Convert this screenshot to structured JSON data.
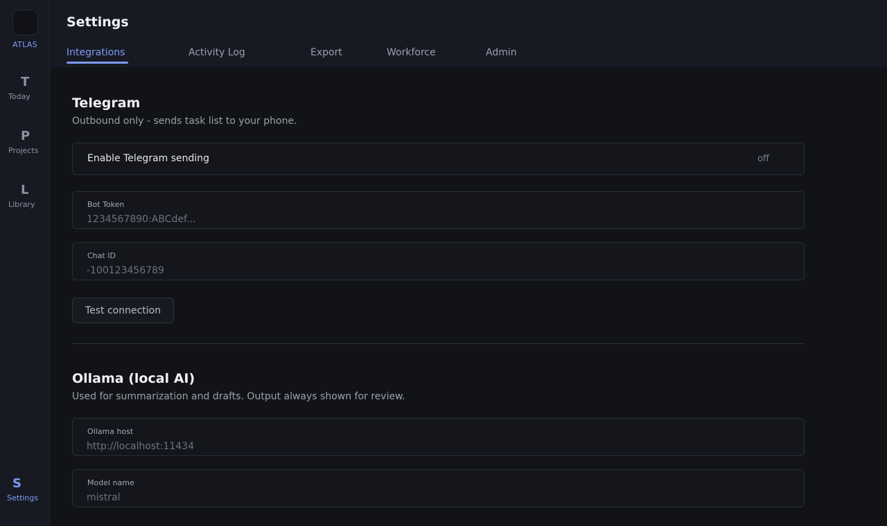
{
  "app": {
    "name": "ATLAS"
  },
  "sidebar": {
    "items": [
      {
        "letter": "T",
        "label": "Today"
      },
      {
        "letter": "P",
        "label": "Projects"
      },
      {
        "letter": "L",
        "label": "Library"
      },
      {
        "letter": "S",
        "label": "Settings"
      }
    ]
  },
  "header": {
    "title": "Settings",
    "tabs": [
      {
        "label": "Integrations"
      },
      {
        "label": "Activity Log"
      },
      {
        "label": "Export"
      },
      {
        "label": "Workforce"
      },
      {
        "label": "Admin"
      }
    ]
  },
  "telegram": {
    "title": "Telegram",
    "description": "Outbound only - sends task list to your phone.",
    "toggle_label": "Enable Telegram sending",
    "toggle_state": "off",
    "bot_token_label": "Bot Token",
    "bot_token_placeholder": "1234567890:ABCdef...",
    "chat_id_label": "Chat ID",
    "chat_id_placeholder": "-100123456789",
    "test_button": "Test connection"
  },
  "ollama": {
    "title": "Ollama (local AI)",
    "description": "Used for summarization and drafts. Output always shown for review.",
    "host_label": "Ollama host",
    "host_placeholder": "http://localhost:11434",
    "model_label": "Model name",
    "model_placeholder": "mistral"
  },
  "colors": {
    "accent": "#7f9cf5",
    "background": "#121317",
    "sidebar": "#171a23"
  }
}
